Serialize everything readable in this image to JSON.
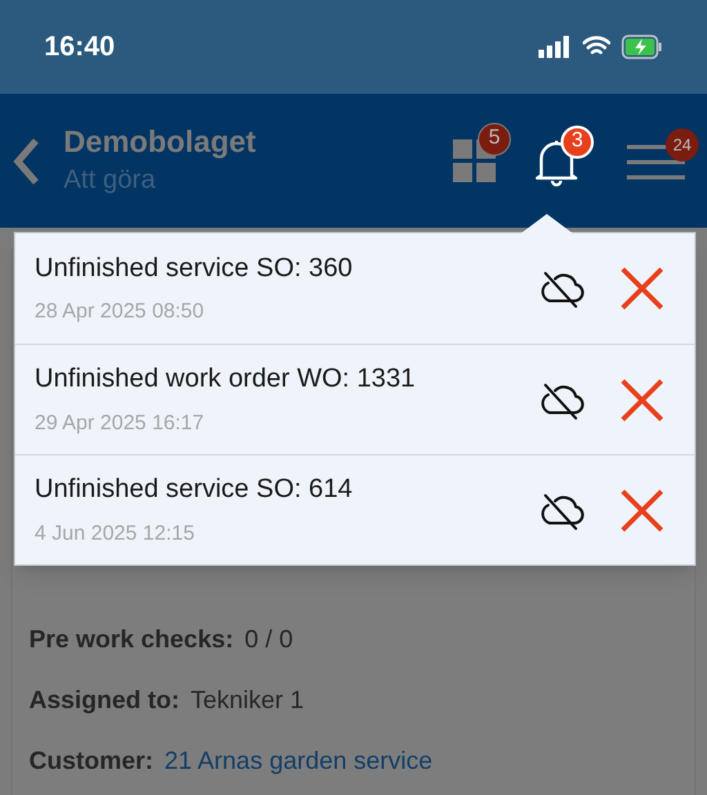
{
  "status_bar": {
    "time": "16:40"
  },
  "header": {
    "title": "Demobolaget",
    "subtitle": "Att göra",
    "apps_badge": "5",
    "notifications_badge": "3",
    "menu_badge": "24"
  },
  "notifications": [
    {
      "title": "Unfinished service SO: 360",
      "date": "28 Apr 2025 08:50"
    },
    {
      "title": "Unfinished work order WO: 1331",
      "date": "29 Apr 2025 16:17"
    },
    {
      "title": "Unfinished service SO: 614",
      "date": "4 Jun 2025 12:15"
    }
  ],
  "details": [
    {
      "label": "Pre work checks:",
      "value": "0 / 0",
      "kind": "text"
    },
    {
      "label": "Assigned to:",
      "value": "Tekniker 1",
      "kind": "text"
    },
    {
      "label": "Customer:",
      "value": "21 Arnas garden service",
      "kind": "link"
    }
  ]
}
